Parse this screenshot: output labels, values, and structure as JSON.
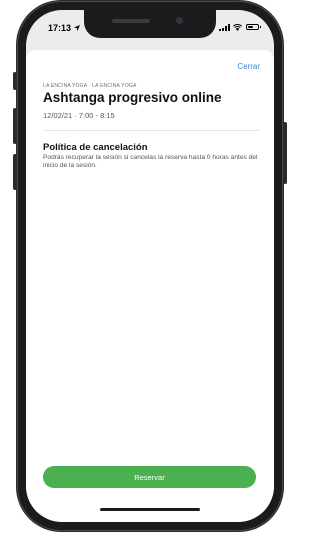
{
  "status_bar": {
    "time": "17:13",
    "location_icon": "location-arrow-icon",
    "signal_icon": "cellular-signal-icon",
    "wifi_icon": "wifi-icon",
    "battery_icon": "battery-icon"
  },
  "sheet": {
    "close_label": "Cerrar",
    "studio_line": "LA ENCINA YOGA · LA ENCINA YOGA",
    "class_title": "Ashtanga progresivo online",
    "datetime": "12/02/21 · 7:00 - 8:15",
    "policy_title": "Política de cancelación",
    "policy_text": "Podrás recuperar la sesión si cancelas la reserva hasta 0 horas antes del inicio de la sesión.",
    "reserve_label": "Reservar"
  },
  "colors": {
    "accent_link": "#3a86d9",
    "reserve_button": "#4cb050",
    "phone_frame": "#1b1b1d"
  }
}
